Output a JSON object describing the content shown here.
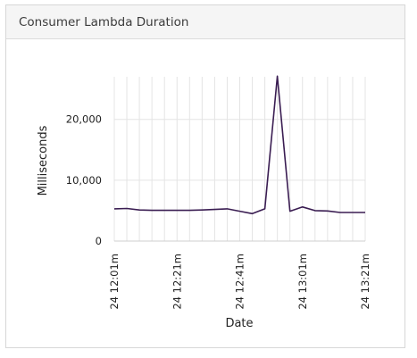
{
  "widget": {
    "title": "Consumer Lambda Duration"
  },
  "chart_data": {
    "type": "line",
    "xlabel": "Date",
    "ylabel": "Milliseconds",
    "ylim": [
      0,
      27000
    ],
    "grid": true,
    "x_ticks": [
      "24 12:01m",
      "24 12:21m",
      "24 12:41m",
      "24 13:01m",
      "24 13:21m"
    ],
    "y_ticks": [
      {
        "value": 0,
        "label": "0"
      },
      {
        "value": 10000,
        "label": "10,000"
      },
      {
        "value": 20000,
        "label": "20,000"
      }
    ],
    "series": [
      {
        "color": "#3a1d52",
        "x": [
          "12:01",
          "12:05",
          "12:09",
          "12:13",
          "12:17",
          "12:21",
          "12:25",
          "12:29",
          "12:33",
          "12:37",
          "12:41",
          "12:45",
          "12:49",
          "12:53",
          "12:57",
          "13:01",
          "13:05",
          "13:09",
          "13:13",
          "13:17",
          "13:21"
        ],
        "values": [
          5300,
          5350,
          5100,
          5050,
          5050,
          5050,
          5050,
          5100,
          5200,
          5300,
          4900,
          4500,
          5300,
          27100,
          4900,
          5600,
          5000,
          4950,
          4700,
          4700,
          4700
        ]
      }
    ]
  }
}
